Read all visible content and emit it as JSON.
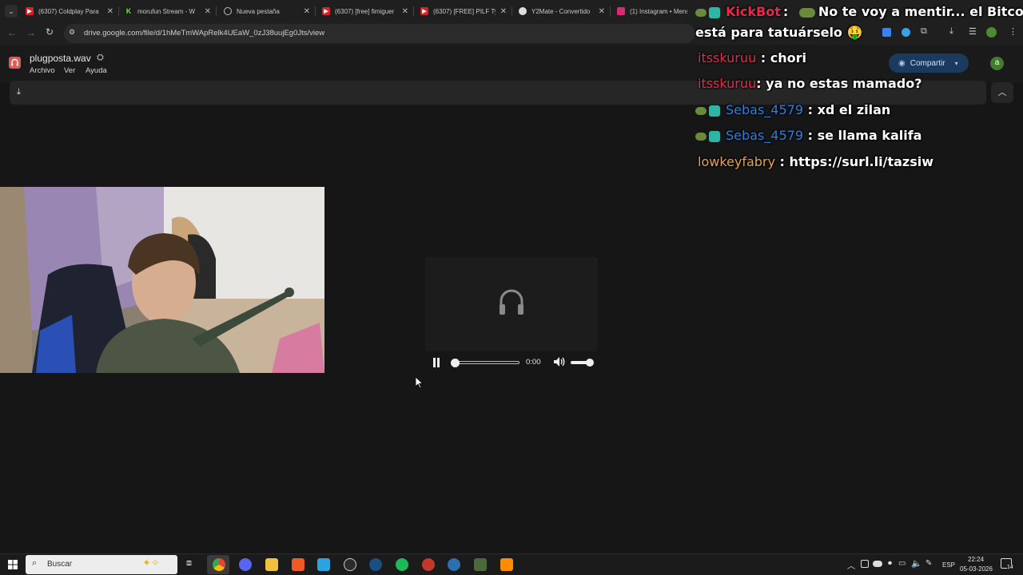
{
  "browser": {
    "tabs": [
      {
        "title": "(6307) Coldplay Para",
        "fav_color": "#e02020"
      },
      {
        "title": "morufun Stream - W",
        "fav_color": "#53fc18"
      },
      {
        "title": "Nueva pestaña",
        "fav_color": "#999999"
      },
      {
        "title": "(6307) [free] fimiguer",
        "fav_color": "#e02020"
      },
      {
        "title": "(6307) [FREE] PILF Ty",
        "fav_color": "#e02020"
      },
      {
        "title": "Y2Mate - Convertido",
        "fav_color": "#cccccc"
      },
      {
        "title": "(1) Instagram • Mens",
        "fav_color": "#d62976"
      }
    ],
    "url": "drive.google.com/file/d/1hMeTmWApRelk4UEaW_0zJ38uujEg0Jts/view"
  },
  "drive": {
    "file_name": "plugposta.wav",
    "menu": [
      "Archivo",
      "Ver",
      "Ayuda"
    ],
    "share_label": "Compartir",
    "avatar_letter": "a"
  },
  "player": {
    "time": "0:00",
    "progress": 0.0,
    "volume": 0.85
  },
  "chat": [
    {
      "user": "KickBot",
      "text": ":",
      "color": "#e8294a",
      "badges": 2
    },
    {
      "user": "",
      "text": "No te voy a mentir... el Bitcoin",
      "color": "#ffffff",
      "badges": 0
    },
    {
      "user": "",
      "text": "está para tatuárselo 🤑",
      "color": "#ffffff",
      "badges": 0
    },
    {
      "user": "itsskuruu",
      "text": ": chori",
      "color": "#e8294a",
      "badges": 0
    },
    {
      "user": "itsskuruu",
      "text": ": ya no estas mamado?",
      "color": "#e8294a",
      "badges": 0
    },
    {
      "user": "Sebas_4579",
      "text": ": xd el zilan",
      "color": "#2f7fd8",
      "badges": 2
    },
    {
      "user": "Sebas_4579",
      "text": ": se llama kalifa",
      "color": "#2f7fd8",
      "badges": 2
    },
    {
      "user": "lowkeyfabry",
      "text": ": https://surl.li/tazsiw",
      "color": "#e5a24a",
      "badges": 0
    }
  ],
  "taskbar": {
    "search_label": "Buscar",
    "language": "ESP",
    "time": "22:24",
    "date": "05-03-2026",
    "notifications": "14"
  }
}
